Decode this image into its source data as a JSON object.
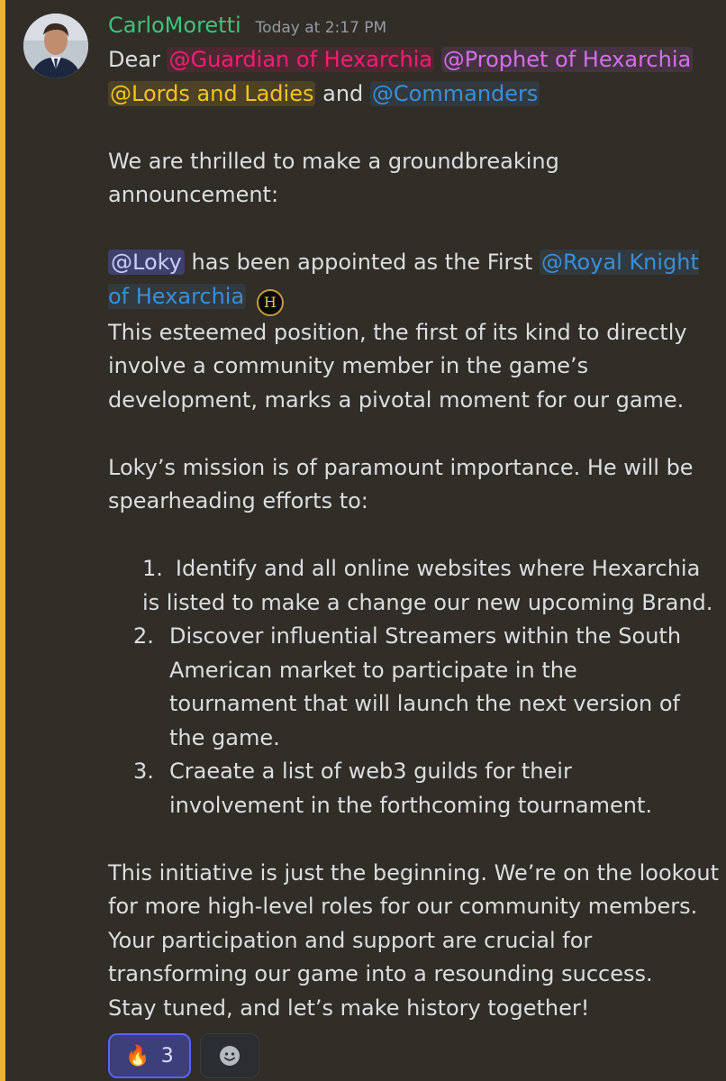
{
  "message": {
    "author": "CarloMoretti",
    "timestamp": "Today at 2:17 PM",
    "greeting": {
      "prefix": "Dear",
      "mentions": [
        "@Guardian of Hexarchia",
        "@Prophet of Hexarchia",
        "@Lords and Ladies",
        "@Commanders"
      ],
      "conjunction": "and"
    },
    "intro": "We are thrilled to make a groundbreaking announcement:",
    "appointment": {
      "user_mention": "@Loky",
      "text": " has been appointed as the First ",
      "role_mention": "@Royal Knight of Hexarchia",
      "emoji_letter": "H"
    },
    "paragraph_position": "This esteemed position, the first of its kind to directly involve a community member in the game’s development, marks a pivotal moment for our game.",
    "paragraph_mission": "Loky’s mission is of paramount importance. He will be spearheading efforts to:",
    "list": [
      {
        "num": "1.",
        "text": "Identify and all online websites where Hexarchia is listed to make a change our new upcoming Brand."
      },
      {
        "num": "2.",
        "text": "Discover influential Streamers within the South American market to participate in the tournament that will launch the next version of the game."
      },
      {
        "num": "3.",
        "text": "Craeate a list of web3 guilds for their involvement in the forthcoming tournament."
      }
    ],
    "closing": [
      "This initiative is just the beginning. We’re on the lookout",
      "for more high-level roles for our community members.",
      "Your participation and support are crucial for",
      "transforming our game into a resounding success.",
      "Stay tuned, and let’s make history together!"
    ]
  },
  "reactions": [
    {
      "emoji": "🔥",
      "count": "3",
      "icon": "fire-icon"
    },
    {
      "icon": "add-reaction-icon"
    }
  ],
  "colors": {
    "background": "#312d27",
    "accent_bar": "#f0b232",
    "username": "#3ec47a",
    "guardian": "#ff1a75",
    "prophet": "#d56ef0",
    "lords": "#f5c320",
    "commanders": "#3a8fd8"
  }
}
